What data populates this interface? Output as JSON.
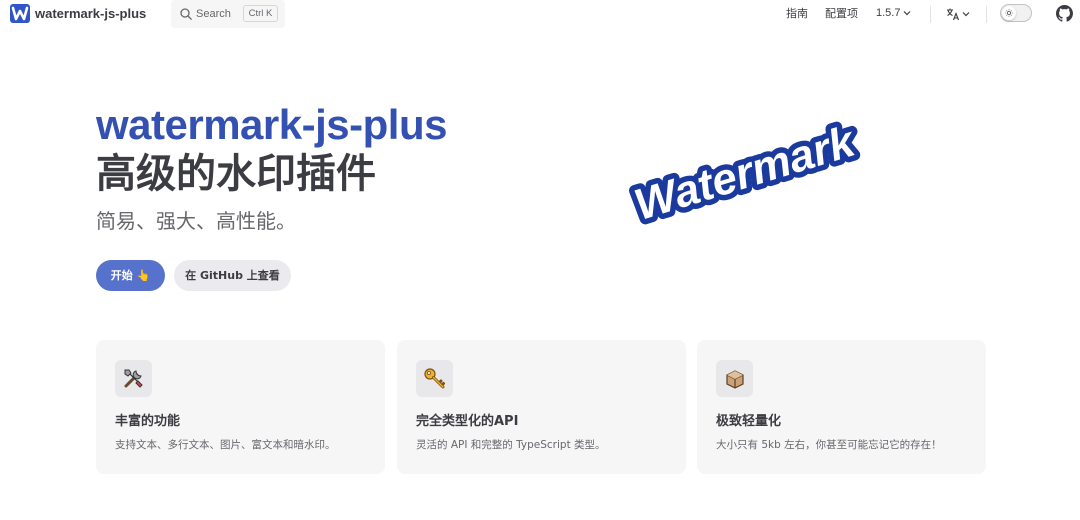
{
  "nav": {
    "title": "watermark-js-plus",
    "search_label": "Search",
    "search_shortcut": "Ctrl K",
    "links": [
      "指南",
      "配置项"
    ],
    "version": "1.5.7",
    "logo_icon": "W-logo-icon",
    "lang_icon": "translate-icon",
    "theme_icon": "sun-icon",
    "social_icon": "github-icon"
  },
  "hero": {
    "name": "watermark-js-plus",
    "text": "高级的水印插件",
    "tagline": "简易、强大、高性能。",
    "actions": [
      {
        "label": "开始 👆"
      },
      {
        "label": "在 GitHub 上查看"
      }
    ],
    "image_text": "Watermark",
    "accent_color": "#3451b2",
    "brand_button_color": "#5672cd"
  },
  "features": [
    {
      "icon": "tools-icon",
      "title": "丰富的功能",
      "details": "支持文本、多行文本、图片、富文本和暗水印。"
    },
    {
      "icon": "key-icon",
      "title": "完全类型化的API",
      "details": "灵活的 API 和完整的 TypeScript 类型。"
    },
    {
      "icon": "package-icon",
      "title": "极致轻量化",
      "details": "大小只有 5kb 左右，你甚至可能忘记它的存在！"
    }
  ]
}
